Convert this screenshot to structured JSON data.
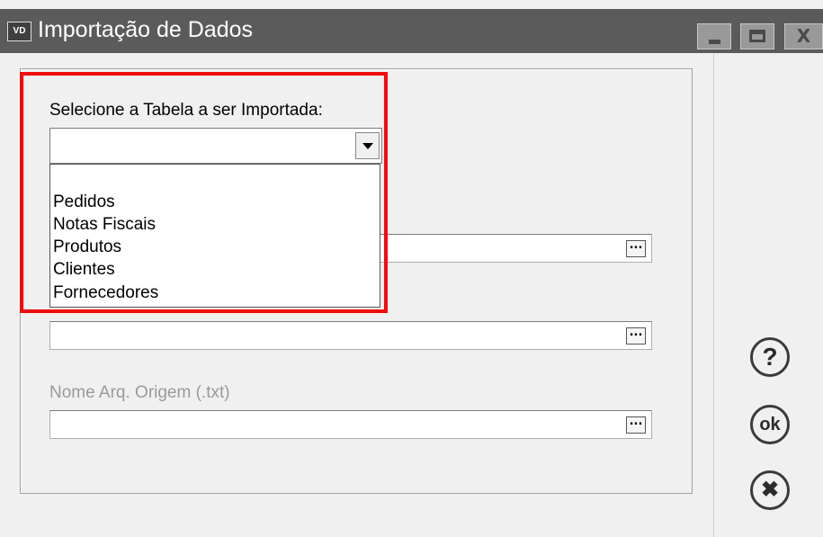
{
  "window": {
    "icon_text": "VD",
    "title": "Importação de Dados",
    "minimize_symbol": "_",
    "close_symbol": "X"
  },
  "form": {
    "table_label": "Selecione a Tabela a ser Importada:",
    "table_selected": "",
    "table_options": [
      "Pedidos",
      "Notas Fiscais",
      "Produtos",
      "Clientes",
      "Fornecedores"
    ],
    "field2_value": "",
    "field3_value": "",
    "origin_label": "Nome Arq. Origem (.txt)",
    "origin_value": "",
    "browse_label": "..."
  },
  "side_buttons": {
    "help_symbol": "?",
    "ok_label": "ok",
    "cancel_symbol": "✖"
  },
  "colors": {
    "highlight_border": "#ee0d0d",
    "titlebar_bg": "#5b5b5b",
    "disabled_text": "#9a9a9a"
  }
}
